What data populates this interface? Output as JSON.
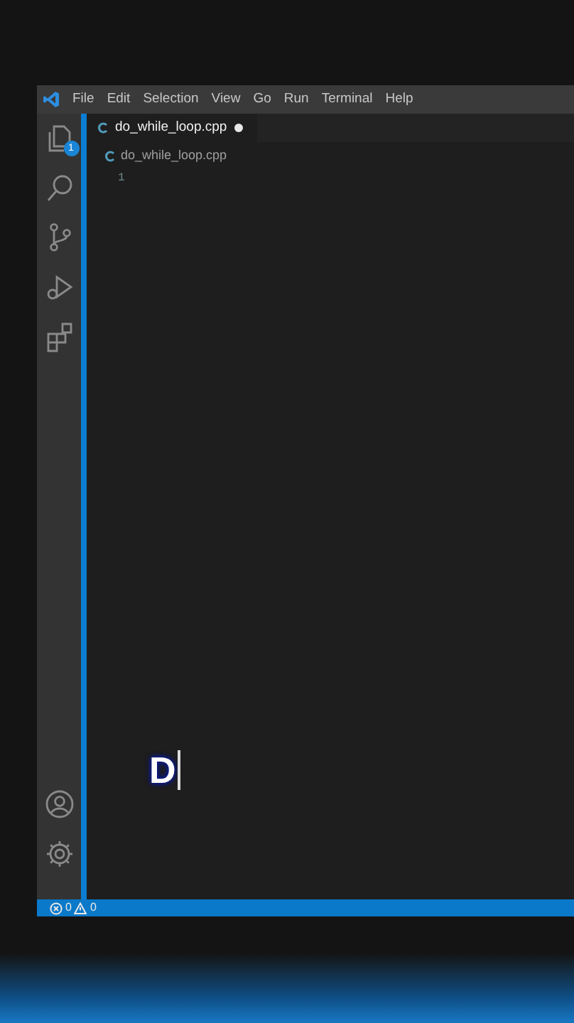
{
  "menu": [
    "File",
    "Edit",
    "Selection",
    "View",
    "Go",
    "Run",
    "Terminal",
    "Help"
  ],
  "explorer_badge": "1",
  "tabs": [
    {
      "label": "do_while_loop.cpp",
      "selected": true,
      "modified": true
    }
  ],
  "breadcrumb": "do_while_loop.cpp",
  "lines": [
    {
      "number": "1"
    }
  ],
  "caption": "D",
  "status_bar": {
    "errors": "0",
    "warnings": "0"
  }
}
